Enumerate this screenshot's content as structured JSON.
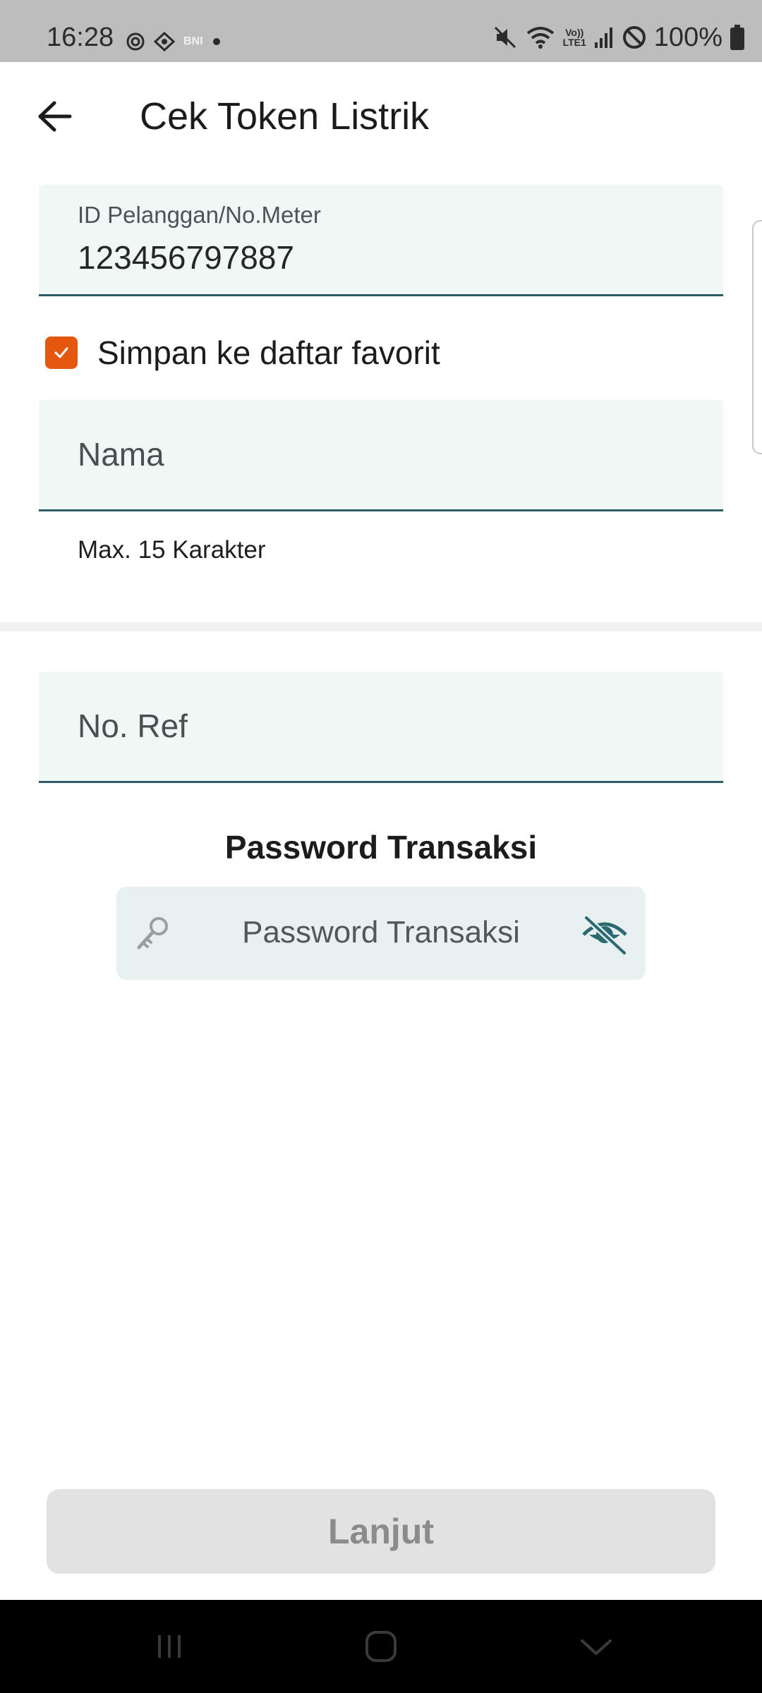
{
  "status_bar": {
    "time": "16:28",
    "bank_badge": "BNI",
    "volte_label": "Vo))",
    "lte_label": "LTE1",
    "battery_percent": "100%",
    "icons": [
      "gear-icon",
      "settings-alt-icon",
      "bni-badge-icon",
      "dot-icon",
      "mute-icon",
      "wifi-icon",
      "volte-icon",
      "signal-icon",
      "no-disturb-icon",
      "battery-icon"
    ]
  },
  "app_bar": {
    "title": "Cek Token Listrik",
    "back_icon": "arrow-left-icon"
  },
  "form": {
    "customer_id": {
      "label": "ID Pelanggan/No.Meter",
      "value": "123456797887"
    },
    "save_favorite": {
      "label": "Simpan ke daftar favorit",
      "checked": true,
      "color": "#e4570f"
    },
    "name": {
      "placeholder": "Nama",
      "helper": "Max. 15 Karakter"
    },
    "ref_no": {
      "placeholder": "No. Ref"
    },
    "password": {
      "title": "Password Transaksi",
      "placeholder": "Password Transaksi",
      "key_icon": "key-icon",
      "visibility_icon": "eye-off-icon"
    }
  },
  "footer": {
    "submit_label": "Lanjut",
    "enabled": false
  },
  "nav_bar": {
    "icons": [
      "recent-apps-icon",
      "home-icon",
      "back-chevron-icon"
    ]
  },
  "colors": {
    "field_bg": "#f0f8f6",
    "field_underline": "#2d5c63",
    "accent_orange": "#e4570f",
    "eye_icon": "#2b6a70"
  }
}
